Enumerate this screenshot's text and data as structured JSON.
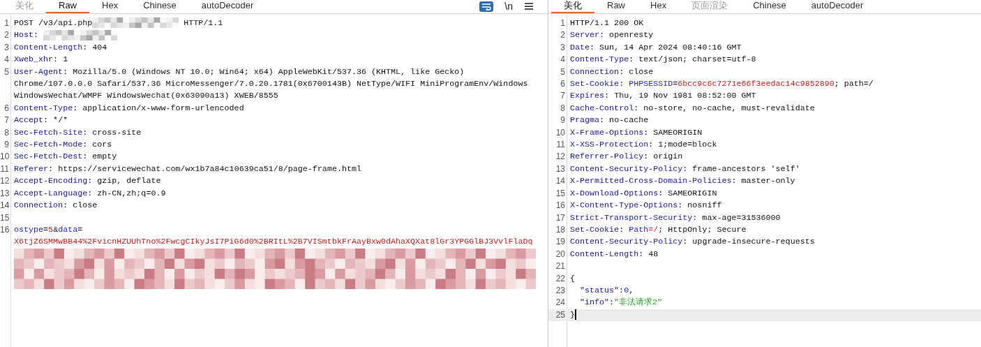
{
  "request": {
    "tabs": [
      {
        "label": "美化",
        "selected": false,
        "disabled": true
      },
      {
        "label": "Raw",
        "selected": true,
        "disabled": false
      },
      {
        "label": "Hex",
        "selected": false,
        "disabled": false
      },
      {
        "label": "Chinese",
        "selected": false,
        "disabled": false
      },
      {
        "label": "autoDecoder",
        "selected": false,
        "disabled": false
      }
    ],
    "toolbar": [
      {
        "kind": "wrap",
        "selected": true
      },
      {
        "kind": "text",
        "label": "\\n",
        "selected": false
      },
      {
        "kind": "menu",
        "selected": false
      }
    ],
    "lines": [
      {
        "number": "1",
        "current": false,
        "segments": [
          {
            "kind": "text",
            "text": "POST /v3/api.php"
          },
          {
            "kind": "redacted-inline"
          },
          {
            "kind": "text",
            "text": " HTTP/1.1"
          }
        ]
      },
      {
        "number": "2",
        "current": false,
        "segments": [
          {
            "kind": "name",
            "text": "Host"
          },
          {
            "kind": "text",
            "text": ": "
          },
          {
            "kind": "redacted-inline"
          }
        ]
      },
      {
        "number": "3",
        "current": false,
        "segments": [
          {
            "kind": "name",
            "text": "Content-Length"
          },
          {
            "kind": "text",
            "text": ": 404"
          }
        ]
      },
      {
        "number": "4",
        "current": false,
        "segments": [
          {
            "kind": "name",
            "text": "Xweb_xhr"
          },
          {
            "kind": "text",
            "text": ": 1"
          }
        ]
      },
      {
        "number": "5",
        "current": false,
        "segments": [
          {
            "kind": "name",
            "text": "User-Agent"
          },
          {
            "kind": "text",
            "text": ": Mozilla/5.0 (Windows NT 10.0; Win64; x64) AppleWebKit/537.36 (KHTML, like Gecko) Chrome/107.0.0.0 Safari/537.36 MicroMessenger/7.0.20.1781(0x6700143B) NetType/WIFI MiniProgramEnv/Windows WindowsWechat/WMPF WindowsWechat(0x63090a13) XWEB/8555"
          }
        ]
      },
      {
        "number": "6",
        "current": false,
        "segments": [
          {
            "kind": "name",
            "text": "Content-Type"
          },
          {
            "kind": "text",
            "text": ": application/x-www-form-urlencoded"
          }
        ]
      },
      {
        "number": "7",
        "current": false,
        "segments": [
          {
            "kind": "name",
            "text": "Accept"
          },
          {
            "kind": "text",
            "text": ": */*"
          }
        ]
      },
      {
        "number": "8",
        "current": false,
        "segments": [
          {
            "kind": "name",
            "text": "Sec-Fetch-Site"
          },
          {
            "kind": "text",
            "text": ": cross-site"
          }
        ]
      },
      {
        "number": "9",
        "current": false,
        "segments": [
          {
            "kind": "name",
            "text": "Sec-Fetch-Mode"
          },
          {
            "kind": "text",
            "text": ": cors"
          }
        ]
      },
      {
        "number": "10",
        "current": false,
        "segments": [
          {
            "kind": "name",
            "text": "Sec-Fetch-Dest"
          },
          {
            "kind": "text",
            "text": ": empty"
          }
        ]
      },
      {
        "number": "11",
        "current": false,
        "segments": [
          {
            "kind": "name",
            "text": "Referer"
          },
          {
            "kind": "text",
            "text": ": https://servicewechat.com/wx1b7a84c10639ca51/8/page-frame.html"
          }
        ]
      },
      {
        "number": "12",
        "current": false,
        "segments": [
          {
            "kind": "name",
            "text": "Accept-Encoding"
          },
          {
            "kind": "text",
            "text": ": gzip, deflate"
          }
        ]
      },
      {
        "number": "13",
        "current": false,
        "segments": [
          {
            "kind": "name",
            "text": "Accept-Language"
          },
          {
            "kind": "text",
            "text": ": zh-CN,zh;q=0.9"
          }
        ]
      },
      {
        "number": "14",
        "current": false,
        "segments": [
          {
            "kind": "name",
            "text": "Connection"
          },
          {
            "kind": "text",
            "text": ": close"
          }
        ]
      },
      {
        "number": "15",
        "current": false
      },
      {
        "number": "16",
        "current": false,
        "segments": [
          {
            "kind": "attr",
            "text": "ostype"
          },
          {
            "kind": "text",
            "text": "="
          },
          {
            "kind": "attrval",
            "text": "5"
          },
          {
            "kind": "text",
            "text": "&"
          },
          {
            "kind": "attr",
            "text": "data"
          },
          {
            "kind": "text",
            "text": "="
          },
          {
            "kind": "attrval",
            "text": "X6tjZ6SMMwBB44%2FvicnHZUUhTno%2FwcgCIkyJsI7PiG6d0%2BRItL%2B7VISmtbkFrAayBxw0dAhaXQXat8lGr3YPGGlBJ3VvlFlaDq"
          },
          {
            "kind": "redacted-block"
          }
        ]
      }
    ]
  },
  "response": {
    "tabs": [
      {
        "label": "美化",
        "selected": true,
        "disabled": false
      },
      {
        "label": "Raw",
        "selected": false,
        "disabled": false
      },
      {
        "label": "Hex",
        "selected": false,
        "disabled": false
      },
      {
        "label": "页面渲染",
        "selected": false,
        "disabled": true
      },
      {
        "label": "Chinese",
        "selected": false,
        "disabled": false
      },
      {
        "label": "autoDecoder",
        "selected": false,
        "disabled": false
      }
    ],
    "lines": [
      {
        "number": "1",
        "current": false,
        "segments": [
          {
            "kind": "text",
            "text": "HTTP/1.1 200 OK"
          }
        ]
      },
      {
        "number": "2",
        "current": false,
        "segments": [
          {
            "kind": "name",
            "text": "Server"
          },
          {
            "kind": "text",
            "text": ": openresty"
          }
        ]
      },
      {
        "number": "3",
        "current": false,
        "segments": [
          {
            "kind": "name",
            "text": "Date"
          },
          {
            "kind": "text",
            "text": ": Sun, 14 Apr 2024 08:40:16 GMT"
          }
        ]
      },
      {
        "number": "4",
        "current": false,
        "segments": [
          {
            "kind": "name",
            "text": "Content-Type"
          },
          {
            "kind": "text",
            "text": ": text/json; charset=utf-8"
          }
        ]
      },
      {
        "number": "5",
        "current": false,
        "segments": [
          {
            "kind": "name",
            "text": "Connection"
          },
          {
            "kind": "text",
            "text": ": close"
          }
        ]
      },
      {
        "number": "6",
        "current": false,
        "segments": [
          {
            "kind": "name",
            "text": "Set-Cookie"
          },
          {
            "kind": "text",
            "text": ": "
          },
          {
            "kind": "attr",
            "text": "PHPSESSID"
          },
          {
            "kind": "text",
            "text": "="
          },
          {
            "kind": "attrval",
            "text": "6bcc9c6c7271e66f3eedac14c9852890"
          },
          {
            "kind": "text",
            "text": "; path=/"
          }
        ]
      },
      {
        "number": "7",
        "current": false,
        "segments": [
          {
            "kind": "name",
            "text": "Expires"
          },
          {
            "kind": "text",
            "text": ": Thu, 19 Nov 1981 08:52:00 GMT"
          }
        ]
      },
      {
        "number": "8",
        "current": false,
        "segments": [
          {
            "kind": "name",
            "text": "Cache-Control"
          },
          {
            "kind": "text",
            "text": ": no-store, no-cache, must-revalidate"
          }
        ]
      },
      {
        "number": "9",
        "current": false,
        "segments": [
          {
            "kind": "name",
            "text": "Pragma"
          },
          {
            "kind": "text",
            "text": ": no-cache"
          }
        ]
      },
      {
        "number": "10",
        "current": false,
        "segments": [
          {
            "kind": "name",
            "text": "X-Frame-Options"
          },
          {
            "kind": "text",
            "text": ": SAMEORIGIN"
          }
        ]
      },
      {
        "number": "11",
        "current": false,
        "segments": [
          {
            "kind": "name",
            "text": "X-XSS-Protection"
          },
          {
            "kind": "text",
            "text": ": 1;mode=block"
          }
        ]
      },
      {
        "number": "12",
        "current": false,
        "segments": [
          {
            "kind": "name",
            "text": "Referrer-Policy"
          },
          {
            "kind": "text",
            "text": ": origin"
          }
        ]
      },
      {
        "number": "13",
        "current": false,
        "segments": [
          {
            "kind": "name",
            "text": "Content-Security-Policy"
          },
          {
            "kind": "text",
            "text": ": frame-ancestors 'self'"
          }
        ]
      },
      {
        "number": "14",
        "current": false,
        "segments": [
          {
            "kind": "name",
            "text": "X-Permitted-Cross-Domain-Policies"
          },
          {
            "kind": "text",
            "text": ": master-only"
          }
        ]
      },
      {
        "number": "15",
        "current": false,
        "segments": [
          {
            "kind": "name",
            "text": "X-Download-Options"
          },
          {
            "kind": "text",
            "text": ": SAMEORIGIN"
          }
        ]
      },
      {
        "number": "16",
        "current": false,
        "segments": [
          {
            "kind": "name",
            "text": "X-Content-Type-Options"
          },
          {
            "kind": "text",
            "text": ": nosniff"
          }
        ]
      },
      {
        "number": "17",
        "current": false,
        "segments": [
          {
            "kind": "name",
            "text": "Strict-Transport-Security"
          },
          {
            "kind": "text",
            "text": ": max-age=31536000"
          }
        ]
      },
      {
        "number": "18",
        "current": false,
        "segments": [
          {
            "kind": "name",
            "text": "Set-Cookie"
          },
          {
            "kind": "text",
            "text": ": "
          },
          {
            "kind": "attr",
            "text": "Path"
          },
          {
            "kind": "attrval",
            "text": "=/"
          },
          {
            "kind": "text",
            "text": "; HttpOnly; Secure"
          }
        ]
      },
      {
        "number": "19",
        "current": false,
        "segments": [
          {
            "kind": "name",
            "text": "Content-Security-Policy"
          },
          {
            "kind": "text",
            "text": ": upgrade-insecure-requests"
          }
        ]
      },
      {
        "number": "20",
        "current": false,
        "segments": [
          {
            "kind": "name",
            "text": "Content-Length"
          },
          {
            "kind": "text",
            "text": ": 48"
          }
        ]
      },
      {
        "number": "21",
        "current": false
      },
      {
        "number": "22",
        "current": false,
        "segments": [
          {
            "kind": "text",
            "text": "{"
          }
        ]
      },
      {
        "number": "23",
        "current": false,
        "indented": true,
        "segments": [
          {
            "kind": "jkey",
            "text": "\"status\""
          },
          {
            "kind": "text",
            "text": ":"
          },
          {
            "kind": "jnum",
            "text": "0"
          },
          {
            "kind": "text",
            "text": ","
          }
        ]
      },
      {
        "number": "24",
        "current": false,
        "indented": true,
        "segments": [
          {
            "kind": "jkey",
            "text": "\"info\""
          },
          {
            "kind": "text",
            "text": ":"
          },
          {
            "kind": "jstr",
            "text": "\"非法请求2\""
          }
        ]
      },
      {
        "number": "25",
        "current": true,
        "segments": [
          {
            "kind": "text",
            "text": "}"
          }
        ]
      }
    ]
  }
}
